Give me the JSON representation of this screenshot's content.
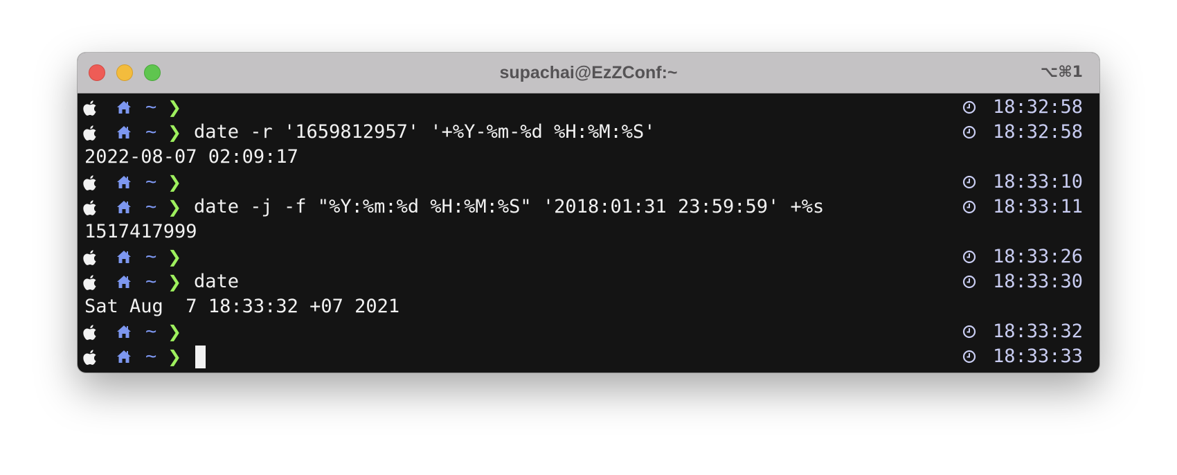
{
  "window": {
    "title": "supachai@EzZConf:~",
    "shortcut": "⌥⌘1"
  },
  "prompt": {
    "dir": "~",
    "chevron": "❯",
    "icons": [
      "apple-icon",
      "home-icon"
    ],
    "colors": {
      "dir": "#7d97f0",
      "chevron": "#9ef05e",
      "time": "#c9cdf2"
    }
  },
  "lines": [
    {
      "type": "prompt",
      "cmd": "",
      "time": "18:32:58"
    },
    {
      "type": "prompt",
      "cmd": "date -r '1659812957' '+%Y-%m-%d %H:%M:%S'",
      "time": "18:32:58"
    },
    {
      "type": "output",
      "text": "2022-08-07 02:09:17"
    },
    {
      "type": "prompt",
      "cmd": "",
      "time": "18:33:10"
    },
    {
      "type": "prompt",
      "cmd": "date -j -f \"%Y:%m:%d %H:%M:%S\" '2018:01:31 23:59:59' +%s",
      "time": "18:33:11"
    },
    {
      "type": "output",
      "text": "1517417999"
    },
    {
      "type": "prompt",
      "cmd": "",
      "time": "18:33:26"
    },
    {
      "type": "prompt",
      "cmd": "date",
      "time": "18:33:30"
    },
    {
      "type": "output",
      "text": "Sat Aug  7 18:33:32 +07 2021"
    },
    {
      "type": "prompt",
      "cmd": "",
      "time": "18:33:32"
    },
    {
      "type": "prompt",
      "cmd": "",
      "time": "18:33:33",
      "cursor": true
    }
  ]
}
